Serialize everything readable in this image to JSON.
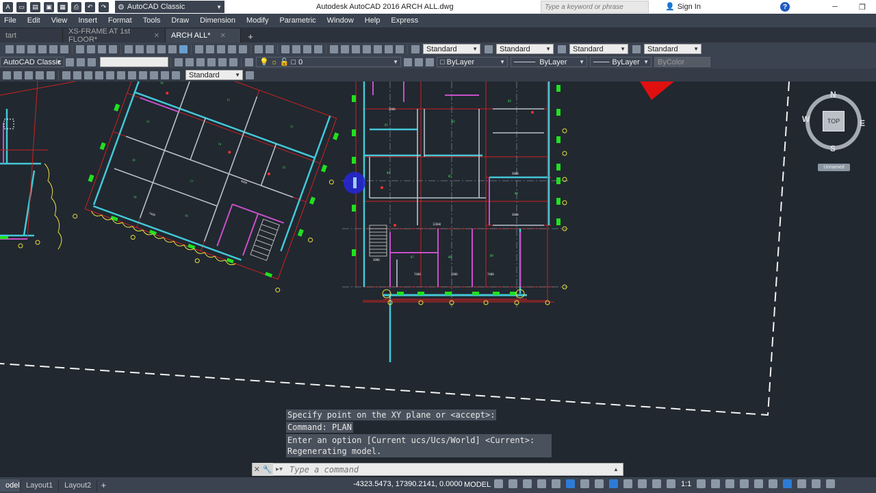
{
  "window": {
    "workspace": "AutoCAD Classic",
    "title": "Autodesk AutoCAD 2016    ARCH ALL.dwg",
    "search_placeholder": "Type a keyword or phrase",
    "sign_in": "Sign In",
    "help": "?"
  },
  "menu": [
    "File",
    "Edit",
    "View",
    "Insert",
    "Format",
    "Tools",
    "Draw",
    "Dimension",
    "Modify",
    "Parametric",
    "Window",
    "Help",
    "Express"
  ],
  "doc_tabs": [
    {
      "label": "tart",
      "active": false,
      "closable": false
    },
    {
      "label": "XS-FRAME AT 1st FLOOR*",
      "active": false,
      "closable": true
    },
    {
      "label": "ARCH ALL*",
      "active": true,
      "closable": true
    }
  ],
  "toolbar_styles": {
    "text_style": "Standard",
    "dim_style": "Standard",
    "table_style": "Standard",
    "mleader_style": "Standard"
  },
  "properties_toolbar": {
    "workspace": "AutoCAD Classic",
    "layer_name": "0",
    "color": "ByLayer",
    "linetype": "ByLayer",
    "lineweight": "ByLayer",
    "plotstyle": "ByColor"
  },
  "styles_toolbar": {
    "visual_style": "Standard"
  },
  "viewcube": {
    "north": "N",
    "south": "S",
    "east": "E",
    "west": "W",
    "face": "TOP",
    "ucs": "Unnamed"
  },
  "command_history": [
    "Specify point on the XY plane or <accept>:",
    "Command: PLAN",
    "Enter an option [Current ucs/Ucs/World] <Current>:",
    "Regenerating model."
  ],
  "command_input": {
    "placeholder": "Type a command"
  },
  "layout_tabs": [
    {
      "label": "odel",
      "active": true
    },
    {
      "label": "Layout1",
      "active": false
    },
    {
      "label": "Layout2",
      "active": false
    }
  ],
  "status": {
    "coordinates": "-4323.5473, 17390.2141, 0.0000",
    "space": "MODEL",
    "scale": "1:1"
  },
  "colors": {
    "background": "#212830",
    "toolbar": "#3b4350",
    "wall_cyan": "#3fd0e0",
    "grid_red": "#e02020",
    "column_green": "#20e020",
    "door_magenta": "#d040d0",
    "tree_yellow": "#e8e040"
  }
}
